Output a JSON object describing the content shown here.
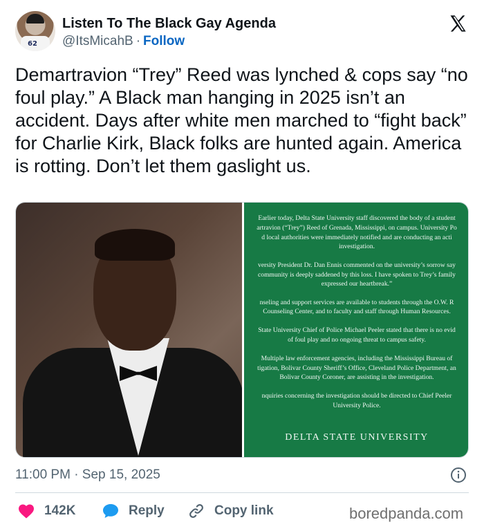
{
  "author": {
    "name": "Listen To The Black Gay Agenda",
    "handle": "@ItsMicahB",
    "separator": "·",
    "follow_label": "Follow"
  },
  "avatar": {
    "jersey_number": "62"
  },
  "tweet": {
    "text": "Demartravion “Trey” Reed was lynched & cops say “no foul play.” A Black man hanging in 2025 isn’t an accident. Days after white men marched to “fight back” for Charlie Kirk, Black folks are hunted again. America is rotting. Don’t let them gaslight us."
  },
  "statement": {
    "lines": [
      "Earlier today, Delta State University staff discovered the body of a student",
      "artravion (“Trey”) Reed of Grenada, Mississippi, on campus. University Po",
      "d local authorities were immediately notified and are conducting an acti",
      "investigation.",
      "versity President Dr. Dan Ennis commented on the university’s sorrow say",
      "community is deeply saddened by this loss. I have spoken to Trey’s family",
      "expressed our heartbreak.”",
      "nseling and support services are available to students through the O.W. R",
      "Counseling Center, and to faculty and staff through Human Resources.",
      "State University Chief of Police Michael Peeler stated that there is no evid",
      "of foul play and no ongoing threat to campus safety.",
      "Multiple law enforcement agencies, including the Mississippi Bureau of",
      "tigation, Bolivar County Sheriff’s Office, Cleveland Police Department, an",
      "Bolivar County Coroner, are assisting in the investigation.",
      "nquiries concerning the investigation should be directed to Chief Peeler",
      "University Police."
    ],
    "signature": "DELTA STATE UNIVERSITY"
  },
  "meta": {
    "timestamp": "11:00 PM · Sep 15, 2025"
  },
  "actions": {
    "likes": "142K",
    "reply_label": "Reply",
    "copy_label": "Copy link"
  },
  "watermark": "boredpanda.com",
  "colors": {
    "like": "#f91880",
    "reply": "#1d9bf0",
    "link": "#0a66c2",
    "muted": "#536471",
    "notice_bg": "#177a45"
  },
  "icons": [
    "x-logo-icon",
    "info-icon",
    "heart-icon",
    "reply-bubble-icon",
    "link-icon"
  ]
}
